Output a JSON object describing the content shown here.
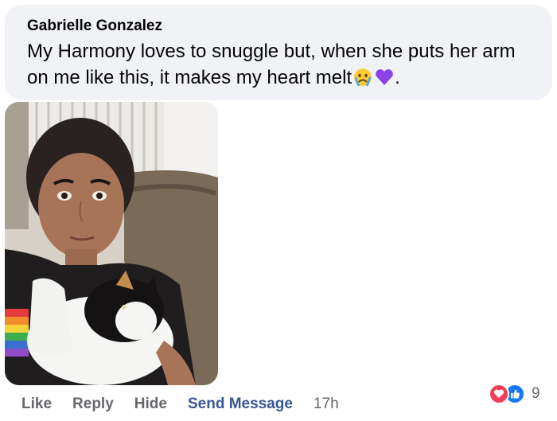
{
  "comment": {
    "author": "Gabrielle Gonzalez",
    "text": "My Harmony loves to snuggle but, when she puts her arm on me like this, it makes my heart melt",
    "trailing_text": ".",
    "emojis": [
      "crying-face-emoji",
      "purple-heart-emoji"
    ]
  },
  "photo": {
    "description_icon": "photo-woman-with-cat"
  },
  "actions": {
    "like": "Like",
    "reply": "Reply",
    "hide": "Hide",
    "send_message": "Send Message",
    "time": "17h"
  },
  "reactions": {
    "icons": [
      "love-reaction-icon",
      "like-reaction-icon"
    ],
    "count": "9"
  },
  "colors": {
    "bubble": "#f0f2f5",
    "link_blue": "#3a5796",
    "muted": "#65676b",
    "love": "#f33e58",
    "like": "#1877f2"
  }
}
